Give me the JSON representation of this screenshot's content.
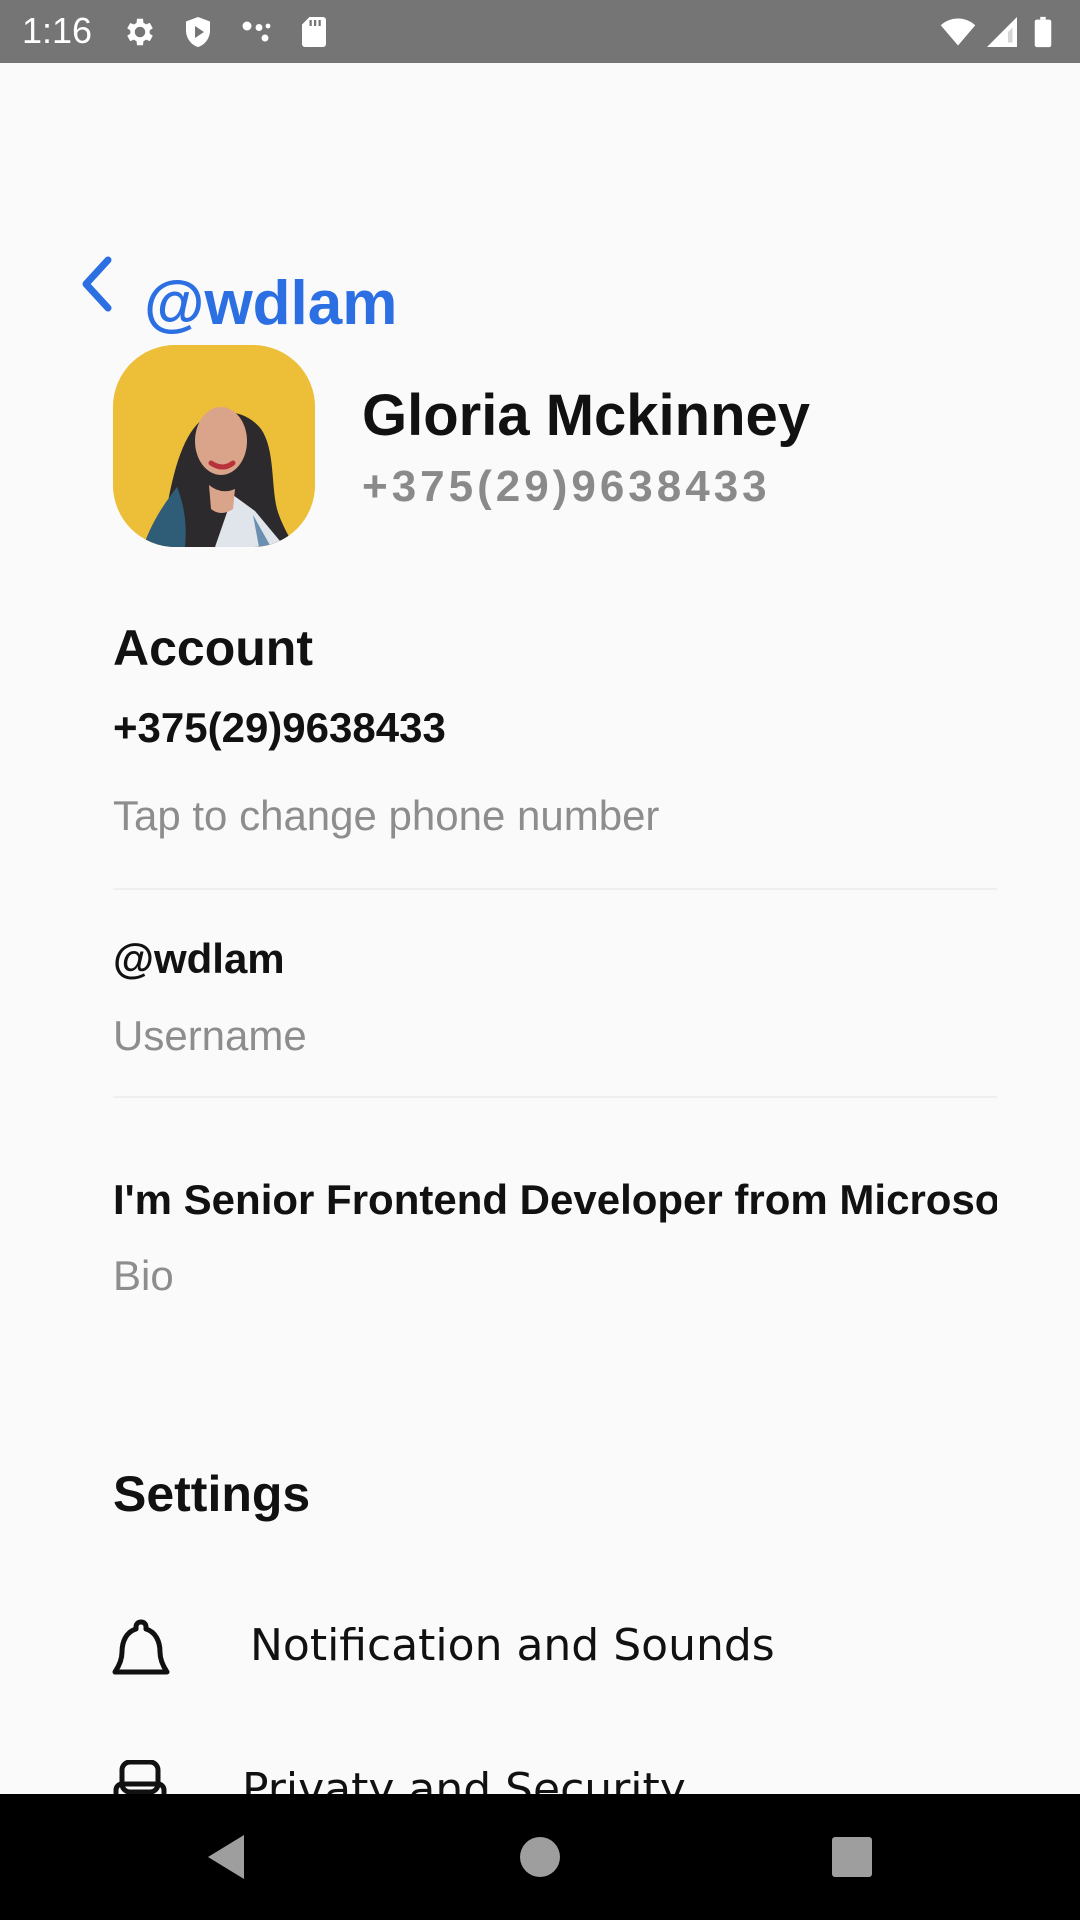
{
  "status_bar": {
    "time": "1:16",
    "icons": [
      "gear-icon",
      "shield-icon",
      "dots-icon",
      "sd-card-icon",
      "wifi-icon",
      "signal-icon",
      "battery-icon"
    ]
  },
  "header": {
    "title": "@wdlam",
    "accent_color": "#2b6fe3"
  },
  "profile": {
    "name": "Gloria Mckinney",
    "phone": "+375(29)9638433"
  },
  "account": {
    "section_title": "Account",
    "phone_value": "+375(29)9638433",
    "phone_hint": "Tap to change phone number",
    "username_value": "@wdlam",
    "username_hint": "Username",
    "bio_value": "I'm Senior Frontend Developer from Microsoft",
    "bio_hint": "Bio"
  },
  "settings": {
    "section_title": "Settings",
    "items": [
      {
        "label": "Notification and Sounds",
        "icon": "bell-icon"
      },
      {
        "label": "Privaty and Security",
        "icon": "lock-icon"
      }
    ]
  },
  "nav_bar": {
    "buttons": [
      "back-icon",
      "home-icon",
      "recents-icon"
    ]
  }
}
